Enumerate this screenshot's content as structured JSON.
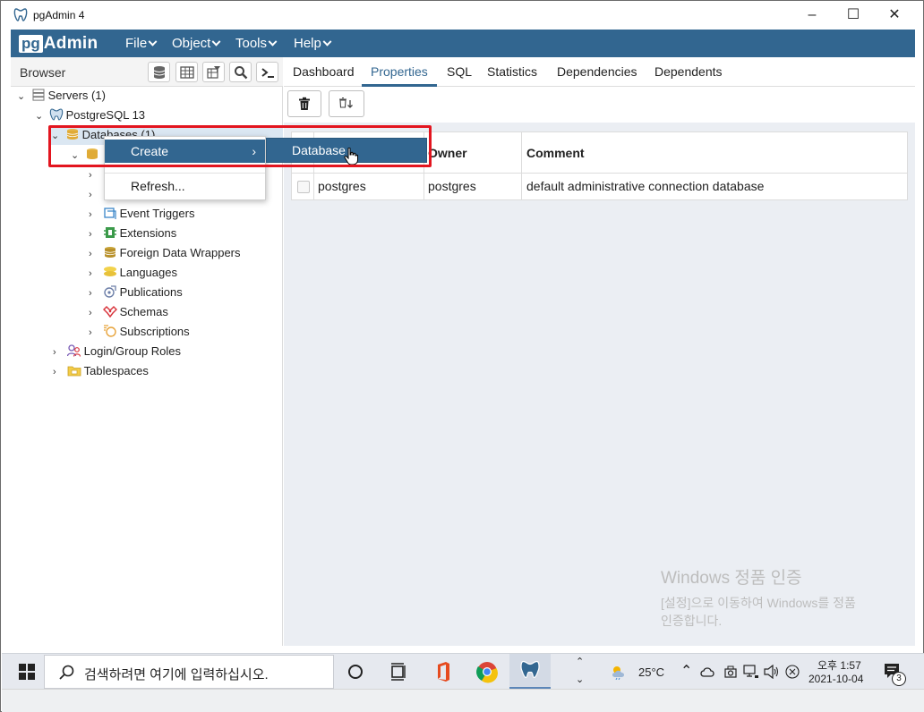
{
  "window": {
    "title": "pgAdmin 4"
  },
  "menubar": {
    "logo_pg": "pg",
    "logo_admin": "Admin",
    "items": [
      {
        "label": "File"
      },
      {
        "label": "Object"
      },
      {
        "label": "Tools"
      },
      {
        "label": "Help"
      }
    ]
  },
  "browser": {
    "label": "Browser",
    "tree": [
      {
        "label": "Servers (1)",
        "icon": "servers-icon"
      },
      {
        "label": "PostgreSQL 13",
        "icon": "postgres-elephant-icon"
      },
      {
        "label": "Databases (1)",
        "icon": "databases-icon"
      },
      {
        "label": "Event Triggers",
        "icon": "event-triggers-icon"
      },
      {
        "label": "Extensions",
        "icon": "extensions-icon"
      },
      {
        "label": "Foreign Data Wrappers",
        "icon": "foreign-data-wrappers-icon"
      },
      {
        "label": "Languages",
        "icon": "languages-icon"
      },
      {
        "label": "Publications",
        "icon": "publications-icon"
      },
      {
        "label": "Schemas",
        "icon": "schemas-icon"
      },
      {
        "label": "Subscriptions",
        "icon": "subscriptions-icon"
      },
      {
        "label": "Login/Group Roles",
        "icon": "login-roles-icon"
      },
      {
        "label": "Tablespaces",
        "icon": "tablespaces-icon"
      }
    ]
  },
  "tabs": [
    {
      "label": "Dashboard"
    },
    {
      "label": "Properties"
    },
    {
      "label": "SQL"
    },
    {
      "label": "Statistics"
    },
    {
      "label": "Dependencies"
    },
    {
      "label": "Dependents"
    }
  ],
  "active_tab": "Properties",
  "grid": {
    "columns": [
      "Owner",
      "Comment"
    ],
    "rows": [
      {
        "name": "postgres",
        "owner": "postgres",
        "comment": "default administrative connection database"
      }
    ]
  },
  "context_menu": {
    "create": "Create",
    "refresh": "Refresh...",
    "submenu_database": "Database"
  },
  "watermark": {
    "title": "Windows 정품 인증",
    "line1": "[설정]으로 이동하여 Windows를 정품",
    "line2": "인증합니다."
  },
  "taskbar": {
    "search_placeholder": "검색하려면 여기에 입력하십시오.",
    "weather": "25°C",
    "time": "오후 1:57",
    "date": "2021-10-04",
    "notification_count": "3"
  },
  "colors": {
    "brand": "#326690",
    "highlight": "#e3151f"
  }
}
